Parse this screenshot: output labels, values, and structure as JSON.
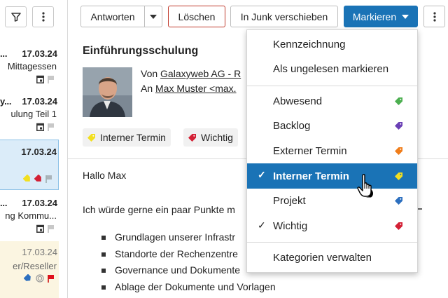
{
  "list": {
    "items": [
      {
        "sender": "...",
        "date": "17.03.24",
        "subject": "Mittagessen",
        "icons": [
          "calendar-icon",
          "flag-icon"
        ]
      },
      {
        "sender": "y...",
        "date": "17.03.24",
        "subject": "ulung Teil 1",
        "icons": [
          "calendar-icon",
          "flag-icon"
        ]
      },
      {
        "sender": "",
        "date": "17.03.24",
        "subject": "",
        "icons": [
          "tag-yellow-icon",
          "tag-red-icon",
          "flag-icon"
        ]
      },
      {
        "sender": "...",
        "date": "17.03.24",
        "subject": "ng Kommu...",
        "icons": [
          "calendar-icon",
          "flag-icon"
        ]
      },
      {
        "sender": "",
        "date": "17.03.24",
        "subject": "er/Reseller",
        "icons": [
          "tag-blue-icon",
          "attachment-icon",
          "flag-red-icon"
        ]
      }
    ]
  },
  "toolbar": {
    "reply_label": "Antworten",
    "delete_label": "Löschen",
    "junk_label": "In Junk verschieben",
    "mark_label": "Markieren"
  },
  "message": {
    "subject": "Einführungsschulung",
    "from_prefix": "Von",
    "from_name": "Galaxyweb AG - R",
    "to_prefix": "An",
    "to_name": "Max Muster <max.",
    "tags": [
      {
        "label": "Interner Termin",
        "color": "#f2df1f"
      },
      {
        "label": "Wichtig",
        "color": "#d32035"
      }
    ],
    "greeting": "Hallo Max",
    "intro": "Ich würde gerne ein paar Punkte m",
    "bullets": [
      "Grundlagen unserer Infrastr",
      "Standorte der Rechenzentre",
      "Governance und Dokumente",
      "Ablage der Dokumente und Vorlagen"
    ]
  },
  "menu": {
    "flag_label": "Kennzeichnung",
    "unread_label": "Als ungelesen markieren",
    "categories": [
      {
        "label": "Abwesend",
        "color": "#4caf50",
        "checked": false
      },
      {
        "label": "Backlog",
        "color": "#6a3fb5",
        "checked": false
      },
      {
        "label": "Externer Termin",
        "color": "#f07d1a",
        "checked": false
      },
      {
        "label": "Interner Termin",
        "color": "#f2df1f",
        "checked": true
      },
      {
        "label": "Projekt",
        "color": "#2c6fbf",
        "checked": false
      },
      {
        "label": "Wichtig",
        "color": "#d32035",
        "checked": true
      }
    ],
    "manage_label": "Kategorien verwalten"
  },
  "colors": {
    "accent": "#1a73b6",
    "selected_row": "#dbecf9",
    "delete_border": "#c0392b"
  }
}
